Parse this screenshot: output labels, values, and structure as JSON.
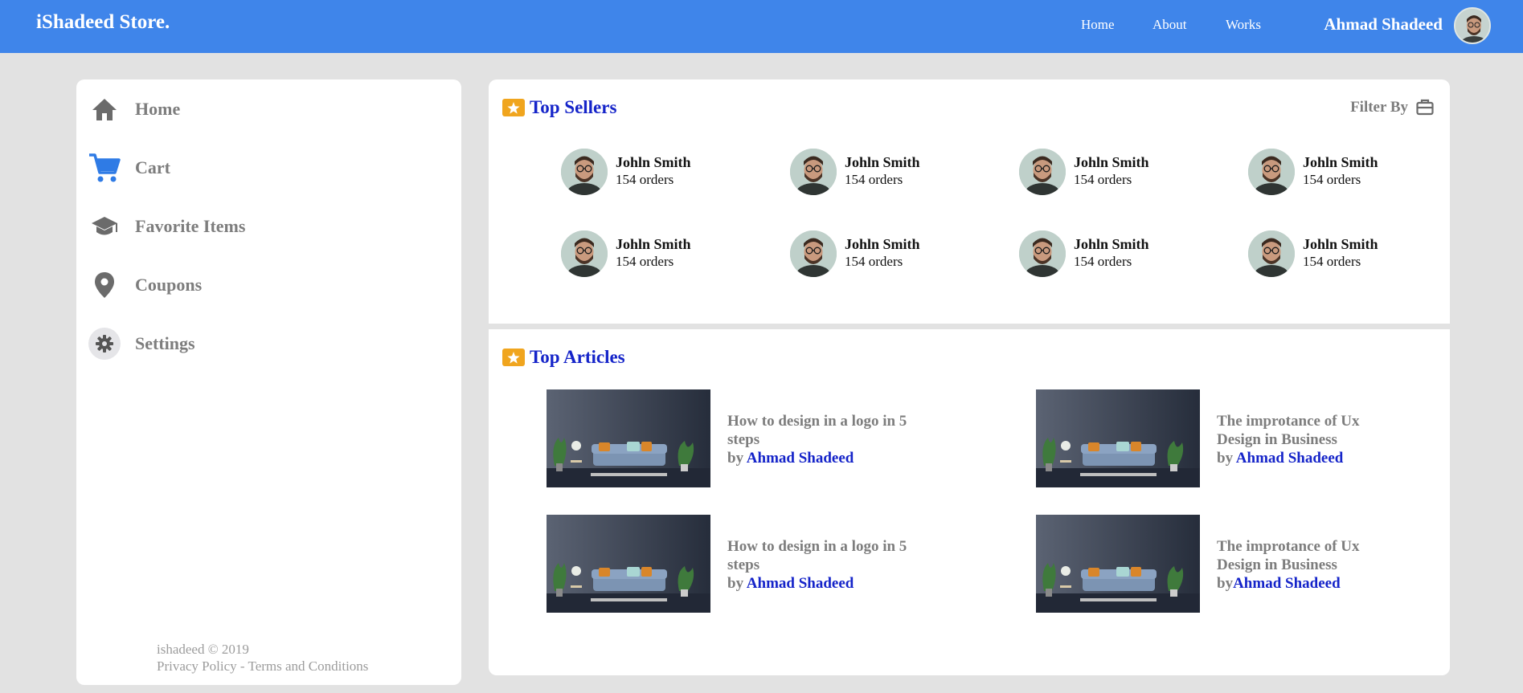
{
  "header": {
    "brand": "iShadeed Store.",
    "nav": [
      "Home",
      "About",
      "Works"
    ],
    "user_name": "Ahmad Shadeed"
  },
  "sidebar": {
    "items": [
      {
        "label": "Home",
        "icon": "home-icon"
      },
      {
        "label": "Cart",
        "icon": "cart-icon"
      },
      {
        "label": "Favorite Items",
        "icon": "graduation-cap-icon"
      },
      {
        "label": "Coupons",
        "icon": "map-pin-icon"
      },
      {
        "label": "Settings",
        "icon": "gear-icon"
      }
    ],
    "footer_copyright": "ishadeed © 2019",
    "footer_privacy": "Privacy Policy",
    "footer_separator": " - ",
    "footer_terms": "Terms and Conditions"
  },
  "top_sellers": {
    "title": "Top Sellers",
    "filter_label": "Filter By",
    "sellers": [
      {
        "name": "Johln Smith",
        "orders": "154 orders"
      },
      {
        "name": "Johln Smith",
        "orders": "154 orders"
      },
      {
        "name": "Johln Smith",
        "orders": "154 orders"
      },
      {
        "name": "Johln Smith",
        "orders": "154 orders"
      },
      {
        "name": "Johln Smith",
        "orders": "154 orders"
      },
      {
        "name": "Johln Smith",
        "orders": "154 orders"
      },
      {
        "name": "Johln Smith",
        "orders": "154 orders"
      },
      {
        "name": "Johln Smith",
        "orders": "154 orders"
      }
    ]
  },
  "top_articles": {
    "title": "Top Articles",
    "articles": [
      {
        "title": "How to design in a logo in 5 steps",
        "by": "by ",
        "author": "Ahmad Shadeed"
      },
      {
        "title": "The improtance of Ux Design in Business",
        "by": "by ",
        "author": "Ahmad Shadeed"
      },
      {
        "title": "How to design in a logo in 5 steps",
        "by": "by ",
        "author": "Ahmad Shadeed"
      },
      {
        "title": "The improtance of Ux Design in Business",
        "by": "by",
        "author": "Ahmad Shadeed"
      }
    ]
  },
  "colors": {
    "header": "#3f85ea",
    "accent_link": "#1524c9",
    "badge": "#f0a51e",
    "muted_text": "#7d7d7d"
  }
}
